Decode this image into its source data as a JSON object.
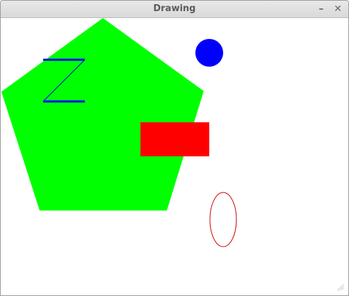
{
  "window": {
    "title": "Drawing",
    "minimize_glyph": "–",
    "close_glyph": "✕"
  },
  "drawing": {
    "colors": {
      "pentagon": "#00ff00",
      "rectangle": "#ff0000",
      "circle": "#0000ff",
      "ellipse_stroke": "#cc0000",
      "z_lines": "#0000ff"
    }
  }
}
